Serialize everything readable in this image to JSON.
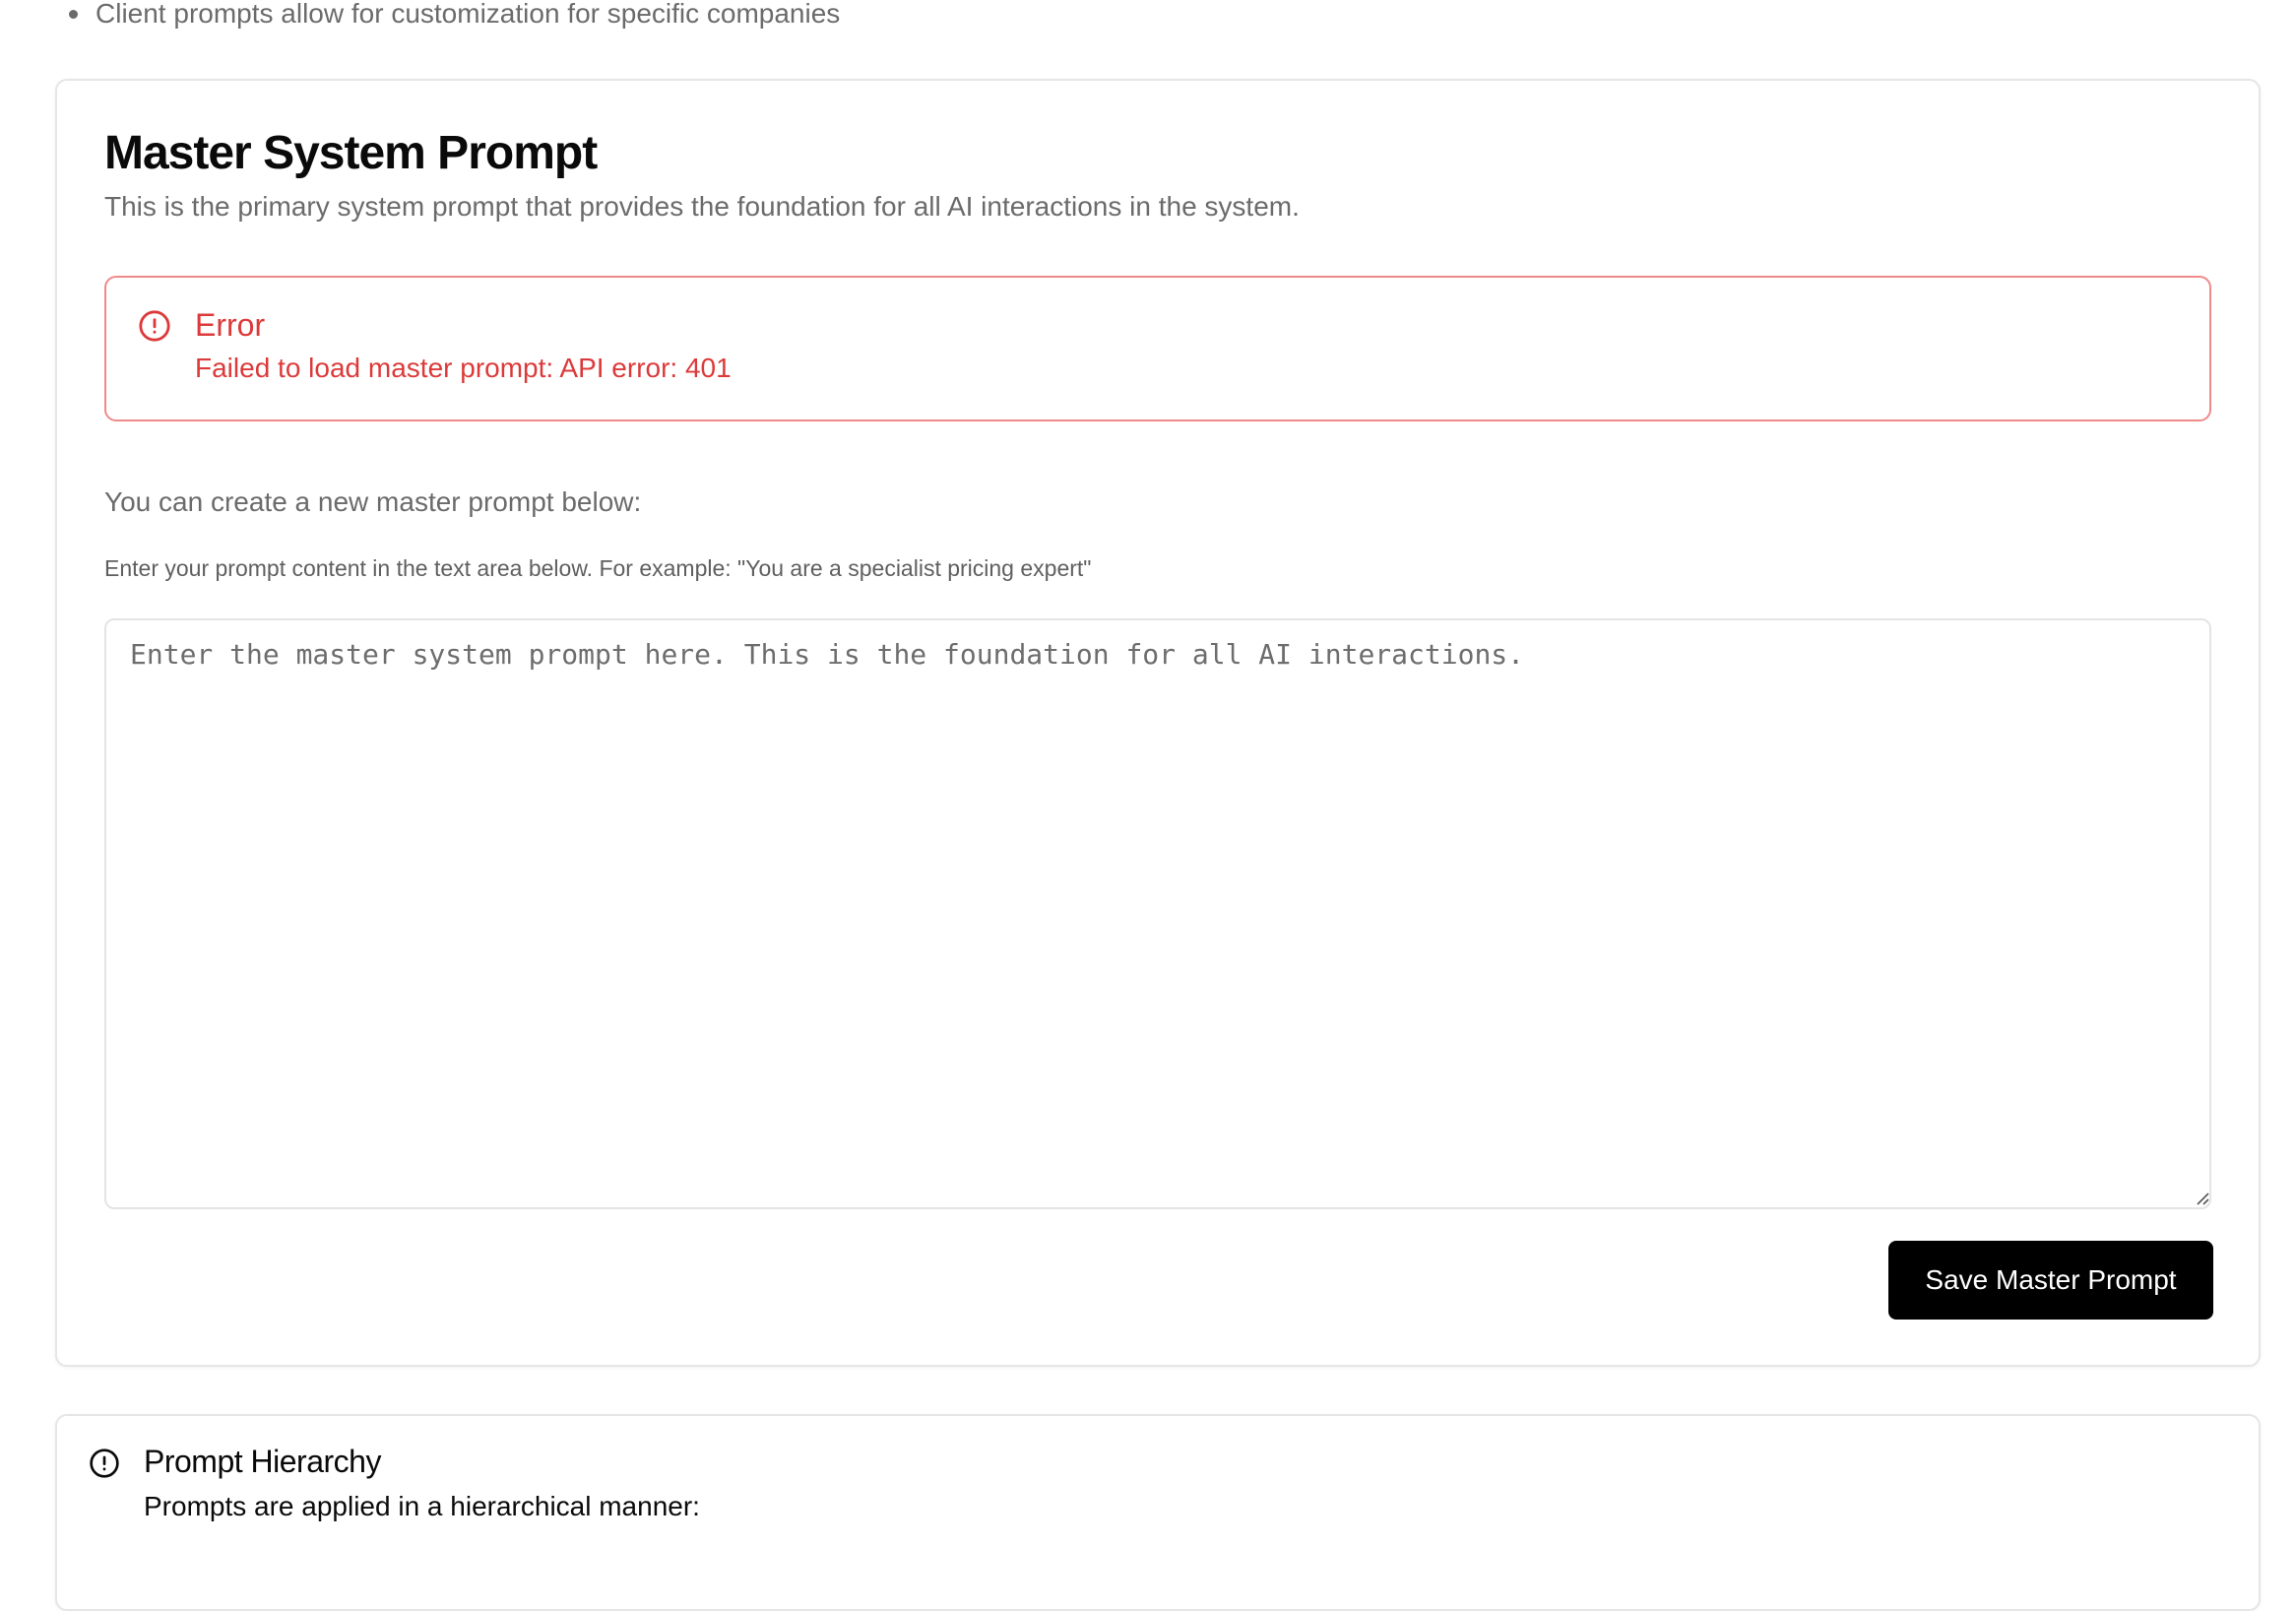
{
  "top_bullet": {
    "text": "Client prompts allow for customization for specific companies"
  },
  "master": {
    "title": "Master System Prompt",
    "description": "This is the primary system prompt that provides the foundation for all AI interactions in the system.",
    "error": {
      "icon": "alert-circle-icon",
      "title": "Error",
      "message": "Failed to load master prompt: API error: 401",
      "color": "#dc3a3a"
    },
    "create_label": "You can create a new master prompt below:",
    "hint": "Enter your prompt content in the text area below. For example: \"You are a specialist pricing expert\"",
    "textarea": {
      "value": "",
      "placeholder": "Enter the master system prompt here. This is the foundation for all AI interactions."
    },
    "save_label": "Save Master Prompt"
  },
  "hierarchy": {
    "icon": "info-circle-icon",
    "title": "Prompt Hierarchy",
    "description": "Prompts are applied in a hierarchical manner:"
  }
}
